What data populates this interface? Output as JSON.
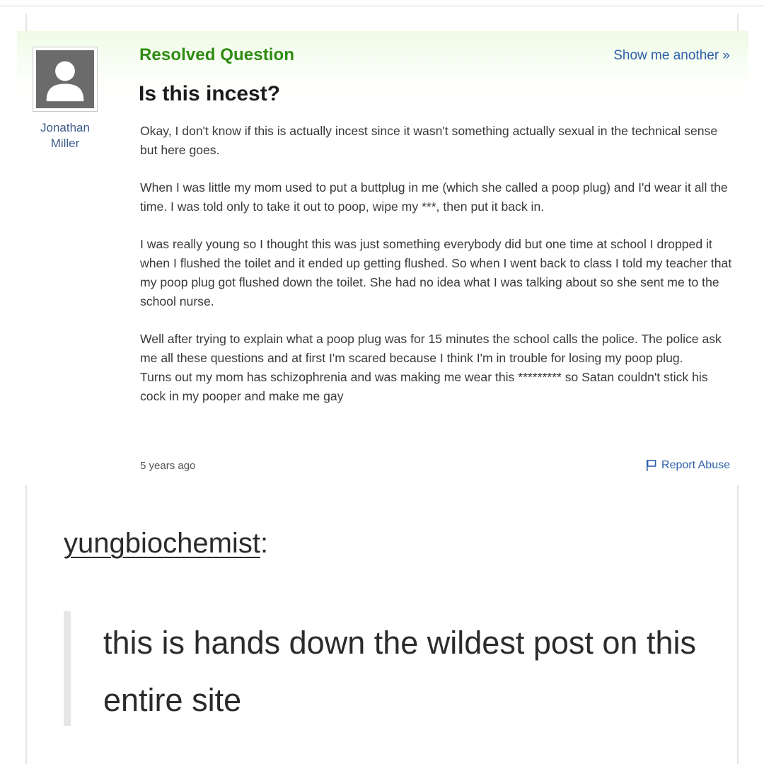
{
  "question_card": {
    "status_label": "Resolved Question",
    "show_another_label": "Show me another »",
    "author": "Jonathan Miller",
    "title": "Is this incest?",
    "body_paragraphs": [
      "Okay, I don't know if this is actually incest since it wasn't something actually sexual in the technical sense but here goes.",
      "When I was little my mom used to put a buttplug in me (which she called a poop plug) and I'd wear it all the time. I was told only to take it out to poop, wipe my ***, then put it back in.",
      "I was really young so I thought this was just something everybody did but one time at school I dropped it when I flushed the toilet and it ended up getting flushed. So when I went back to class I told my teacher that my poop plug got flushed down the toilet. She had no idea what I was talking about so she sent me to the school nurse.",
      "Well after trying to explain what a poop plug was for 15 minutes the school calls the police. The police ask me all these questions and at first I'm scared because I think I'm in trouble for losing my poop plug.",
      "Turns out my mom has schizophrenia and was making me wear this ********* so Satan couldn't stick his cock in my pooper and make me gay"
    ],
    "posted_ago": "5 years ago",
    "report_abuse_label": "Report Abuse",
    "icons": {
      "avatar": "default-user-avatar-icon",
      "report": "flag-icon"
    },
    "colors": {
      "status_green": "#2f8c12",
      "link_blue": "#2c5fa8"
    }
  },
  "reblog": {
    "username": "yungbiochemist",
    "separator": ":",
    "quote": "this is hands down the wildest post on this entire site"
  }
}
